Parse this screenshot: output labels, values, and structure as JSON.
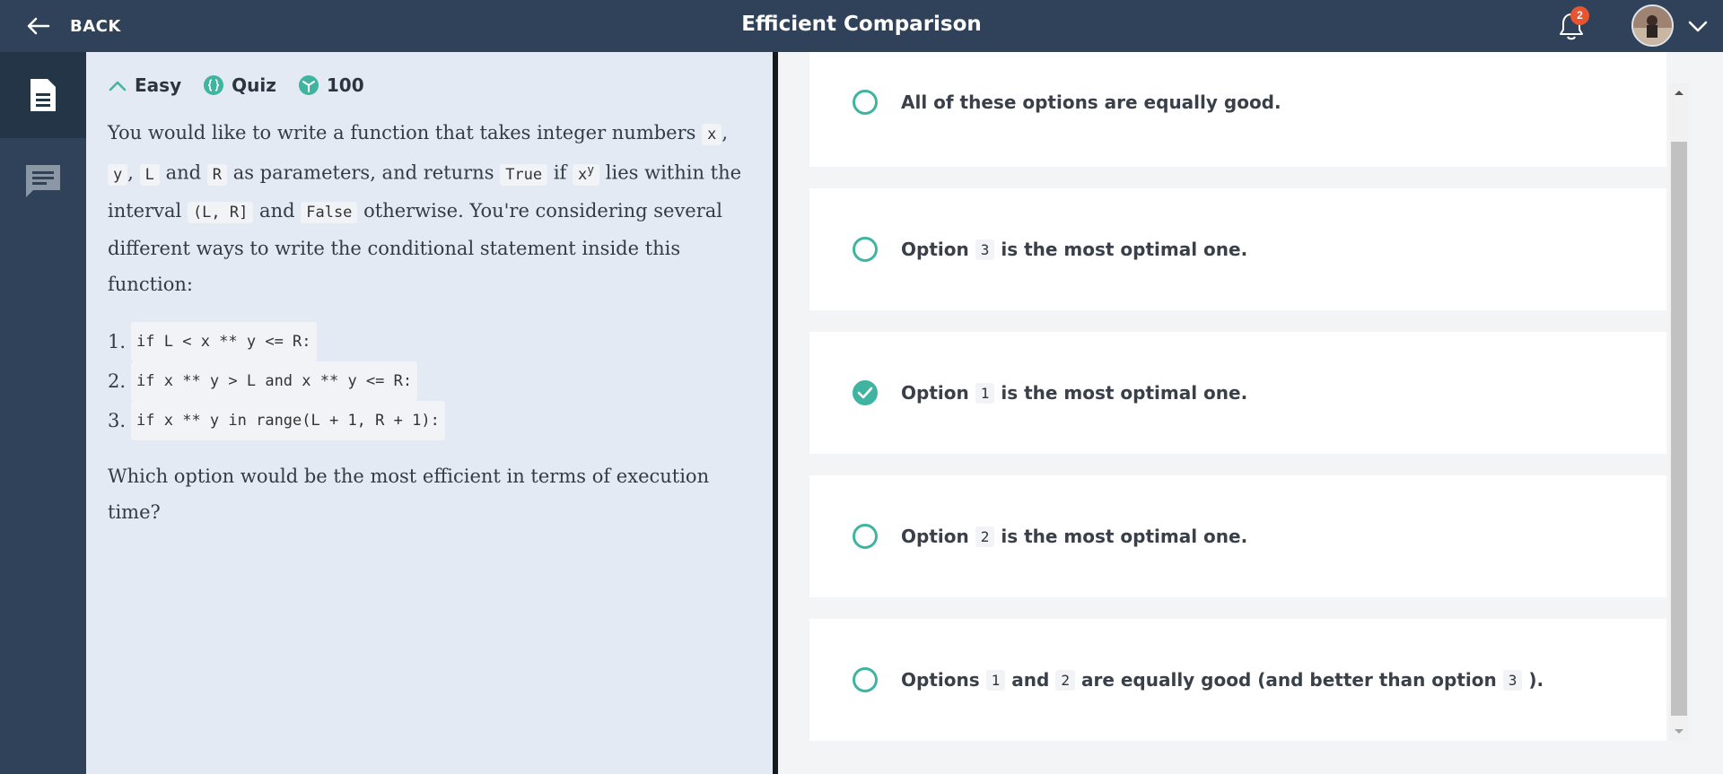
{
  "header": {
    "back_label": "BACK",
    "title": "Efficient Comparison",
    "notification_count": "2"
  },
  "rail": {
    "items": [
      {
        "icon": "document-icon",
        "active": true
      },
      {
        "icon": "chat-icon",
        "active": false
      }
    ]
  },
  "problem": {
    "difficulty": "Easy",
    "type": "Quiz",
    "points": "100",
    "description": {
      "p1": "You would like to write a function that takes integer numbers",
      "x": "x",
      "comma1": ",",
      "y": "y",
      "comma2": ",",
      "L": "L",
      "and1": "and",
      "R": "R",
      "as_params": "as parameters, and returns",
      "true_code": "True",
      "if_word": "if",
      "xy_base": "x",
      "xy_exp": "y",
      "lies_within": "lies within the interval",
      "interval": "(L, R]",
      "and2": "and",
      "false_code": "False",
      "rest": "otherwise. You're considering several different ways to write the conditional statement inside this function:"
    },
    "options": [
      {
        "num": "1.",
        "code": "if L < x ** y <= R:"
      },
      {
        "num": "2.",
        "code": "if x ** y > L and x ** y <= R:"
      },
      {
        "num": "3.",
        "code": "if x ** y in range(L + 1, R + 1):"
      }
    ],
    "question": "Which option would be the most efficient in terms of execution time?"
  },
  "answers": [
    {
      "pre": "All of these options are equally good.",
      "checked": false
    },
    {
      "pre": "Option",
      "code1": "3",
      "post": "is the most optimal one.",
      "checked": false
    },
    {
      "pre": "Option",
      "code1": "1",
      "post": "is the most optimal one.",
      "checked": true
    },
    {
      "pre": "Option",
      "code1": "2",
      "post": "is the most optimal one.",
      "checked": false
    },
    {
      "pre": "Options",
      "code1": "1",
      "mid": "and",
      "code2": "2",
      "post": "are equally good (and better than option",
      "code3": "3",
      "end": ")."
    }
  ],
  "colors": {
    "header_bg": "#2f4259",
    "accent": "#3fb4a0",
    "badge": "#e8542f",
    "problem_bg": "#e3eaf3"
  }
}
